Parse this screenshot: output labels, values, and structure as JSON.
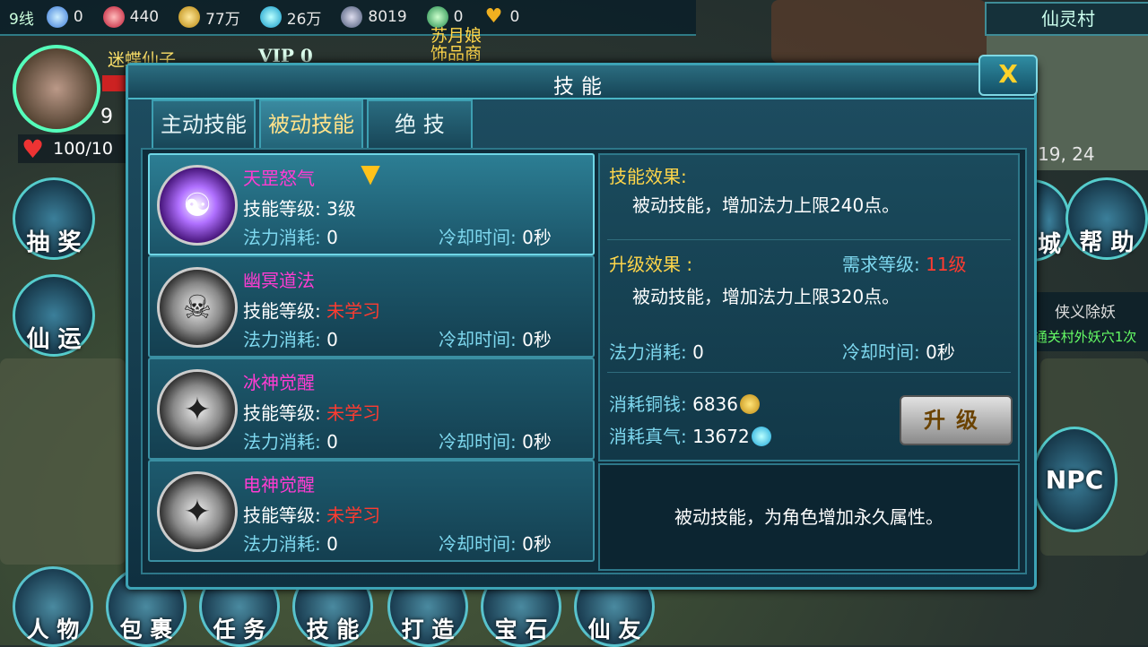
{
  "topbar": {
    "server": "9线",
    "resources": [
      {
        "icon": "diamond-icon",
        "value": "0",
        "color": "#5aa8ff"
      },
      {
        "icon": "ruby-icon",
        "value": "440",
        "color": "#e0344a"
      },
      {
        "icon": "gold-coin-icon",
        "value": "77万",
        "color": "#e8b43a"
      },
      {
        "icon": "spirit-energy-icon",
        "value": "26万",
        "color": "#28c8e0"
      },
      {
        "icon": "eye-orb-icon",
        "value": "8019",
        "color": "#8aa0c0"
      },
      {
        "icon": "jade-token-icon",
        "value": "0",
        "color": "#3cc070"
      },
      {
        "icon": "heart-gold-icon",
        "value": "0",
        "color": "#f0b020"
      }
    ]
  },
  "player": {
    "name": "迷蝶仙子",
    "vip": "VIP 0",
    "level": "9",
    "hp": "100/10"
  },
  "world": {
    "npc_name_line1": "苏月娘",
    "npc_name_line2": "饰品商",
    "map_name": "仙灵村",
    "coords": "19, 24",
    "quest_title": "侠义除妖",
    "quest_detail": "通关村外妖穴1次"
  },
  "side_buttons": [
    {
      "label": "抽 奖",
      "icon": "lottery-gem-icon"
    },
    {
      "label": "仙 运",
      "icon": "treasure-chest-icon"
    },
    {
      "label": "城",
      "icon": "city-icon"
    },
    {
      "label": "帮 助",
      "icon": "help-book-icon"
    },
    {
      "label": "NPC",
      "icon": "chat-bubble-icon"
    }
  ],
  "bottom_nav": [
    {
      "label": "人 物",
      "icon": "character-icon"
    },
    {
      "label": "包 裹",
      "icon": "bag-icon"
    },
    {
      "label": "任 务",
      "icon": "quest-scroll-icon"
    },
    {
      "label": "技 能",
      "icon": "skill-book-icon"
    },
    {
      "label": "打 造",
      "icon": "forge-hammer-icon"
    },
    {
      "label": "宝 石",
      "icon": "gem-icon"
    },
    {
      "label": "仙 友",
      "icon": "friends-icon"
    }
  ],
  "dialog": {
    "title": "技能",
    "close_label": "X",
    "tabs": [
      {
        "label": "主动技能",
        "active": false
      },
      {
        "label": "被动技能",
        "active": true
      },
      {
        "label": "绝 技",
        "active": false
      }
    ],
    "skills": [
      {
        "name": "天罡怒气",
        "level_label": "技能等级:",
        "level": "3级",
        "mp_label": "法力消耗:",
        "mp": "0",
        "cd_label": "冷却时间:",
        "cd": "0秒",
        "learned": true,
        "icon": "meditation-aura-icon"
      },
      {
        "name": "幽冥道法",
        "level_label": "技能等级:",
        "level": "未学习",
        "mp_label": "法力消耗:",
        "mp": "0",
        "cd_label": "冷却时间:",
        "cd": "0秒",
        "learned": false,
        "icon": "skull-spirit-icon"
      },
      {
        "name": "冰神觉醒",
        "level_label": "技能等级:",
        "level": "未学习",
        "mp_label": "法力消耗:",
        "mp": "0",
        "cd_label": "冷却时间:",
        "cd": "0秒",
        "learned": false,
        "icon": "warrior-silhouette-icon"
      },
      {
        "name": "电神觉醒",
        "level_label": "技能等级:",
        "level": "未学习",
        "mp_label": "法力消耗:",
        "mp": "0",
        "cd_label": "冷却时间:",
        "cd": "0秒",
        "learned": false,
        "icon": "warrior-silhouette-icon"
      }
    ],
    "detail": {
      "effect_title": "技能效果:",
      "effect_text": "被动技能，增加法力上限240点。",
      "upgrade_title": "升级效果 :",
      "req_label": "需求等级:",
      "req_value": "11级",
      "upgrade_text": "被动技能，增加法力上限320点。",
      "mp_label": "法力消耗:",
      "mp": "0",
      "cd_label": "冷却时间:",
      "cd": "0秒",
      "copper_label": "消耗铜钱:",
      "copper": "6836",
      "qi_label": "消耗真气:",
      "qi": "13672",
      "upgrade_button": "升级"
    },
    "description": "被动技能，为角色增加永久属性。"
  }
}
